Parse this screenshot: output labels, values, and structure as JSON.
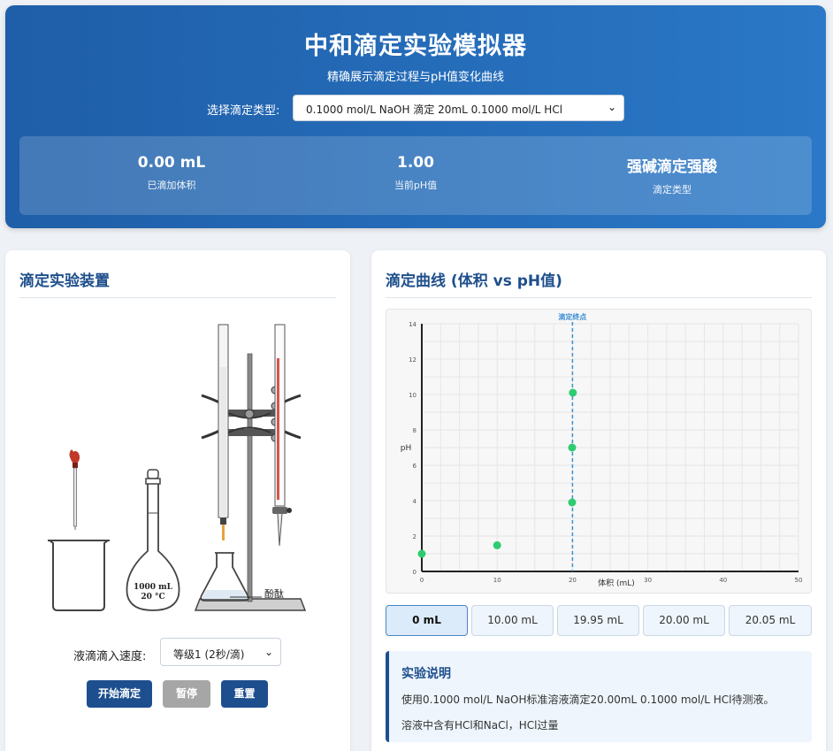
{
  "header": {
    "title": "中和滴定实验模拟器",
    "subtitle": "精确展示滴定过程与pH值变化曲线",
    "select_label": "选择滴定类型:",
    "select_value": "0.1000 mol/L NaOH 滴定 20mL 0.1000 mol/L HCl"
  },
  "stats": [
    {
      "value": "0.00 mL",
      "label": "已滴加体积"
    },
    {
      "value": "1.00",
      "label": "当前pH值"
    },
    {
      "value": "强碱滴定强酸",
      "label": "滴定类型"
    }
  ],
  "left_panel": {
    "title": "滴定实验装置",
    "indicator_label": "酚酞",
    "beaker_label": "",
    "flask_label_1": "1000 mL",
    "flask_label_2": "20 °C",
    "speed_label": "液滴滴入速度:",
    "speed_value": "等级1 (2秒/滴)",
    "buttons": {
      "start": "开始滴定",
      "pause": "暂停",
      "reset": "重置"
    }
  },
  "right_panel": {
    "title": "滴定曲线 (体积 vs pH值)",
    "volume_buttons": [
      "0 mL",
      "10.00 mL",
      "19.95 mL",
      "20.00 mL",
      "20.05 mL"
    ],
    "active_volume": "0 mL",
    "info": {
      "title": "实验说明",
      "lines": [
        "使用0.1000 mol/L NaOH标准溶液滴定20.00mL 0.1000 mol/L HCl待测液。",
        "溶液中含有HCl和NaCl，HCl过量"
      ]
    }
  },
  "colors": {
    "accent": "#1d4f8f",
    "point": "#2ecc71",
    "endpoint_line": "#3a8fd6"
  },
  "chart_data": {
    "type": "scatter",
    "title": "",
    "xlabel": "体积 (mL)",
    "ylabel": "pH",
    "xlim": [
      0,
      50
    ],
    "ylim": [
      0,
      14
    ],
    "x_ticks": [
      0,
      10,
      20,
      30,
      40,
      50
    ],
    "y_ticks": [
      0,
      2,
      4,
      6,
      8,
      10,
      12,
      14
    ],
    "grid": true,
    "points": [
      {
        "x": 0,
        "y": 1.0
      },
      {
        "x": 10,
        "y": 1.48
      },
      {
        "x": 19.95,
        "y": 3.9
      },
      {
        "x": 19.95,
        "y": 7.0
      },
      {
        "x": 20.05,
        "y": 10.1
      }
    ],
    "endpoint": {
      "x": 20,
      "label": "滴定终点"
    }
  }
}
